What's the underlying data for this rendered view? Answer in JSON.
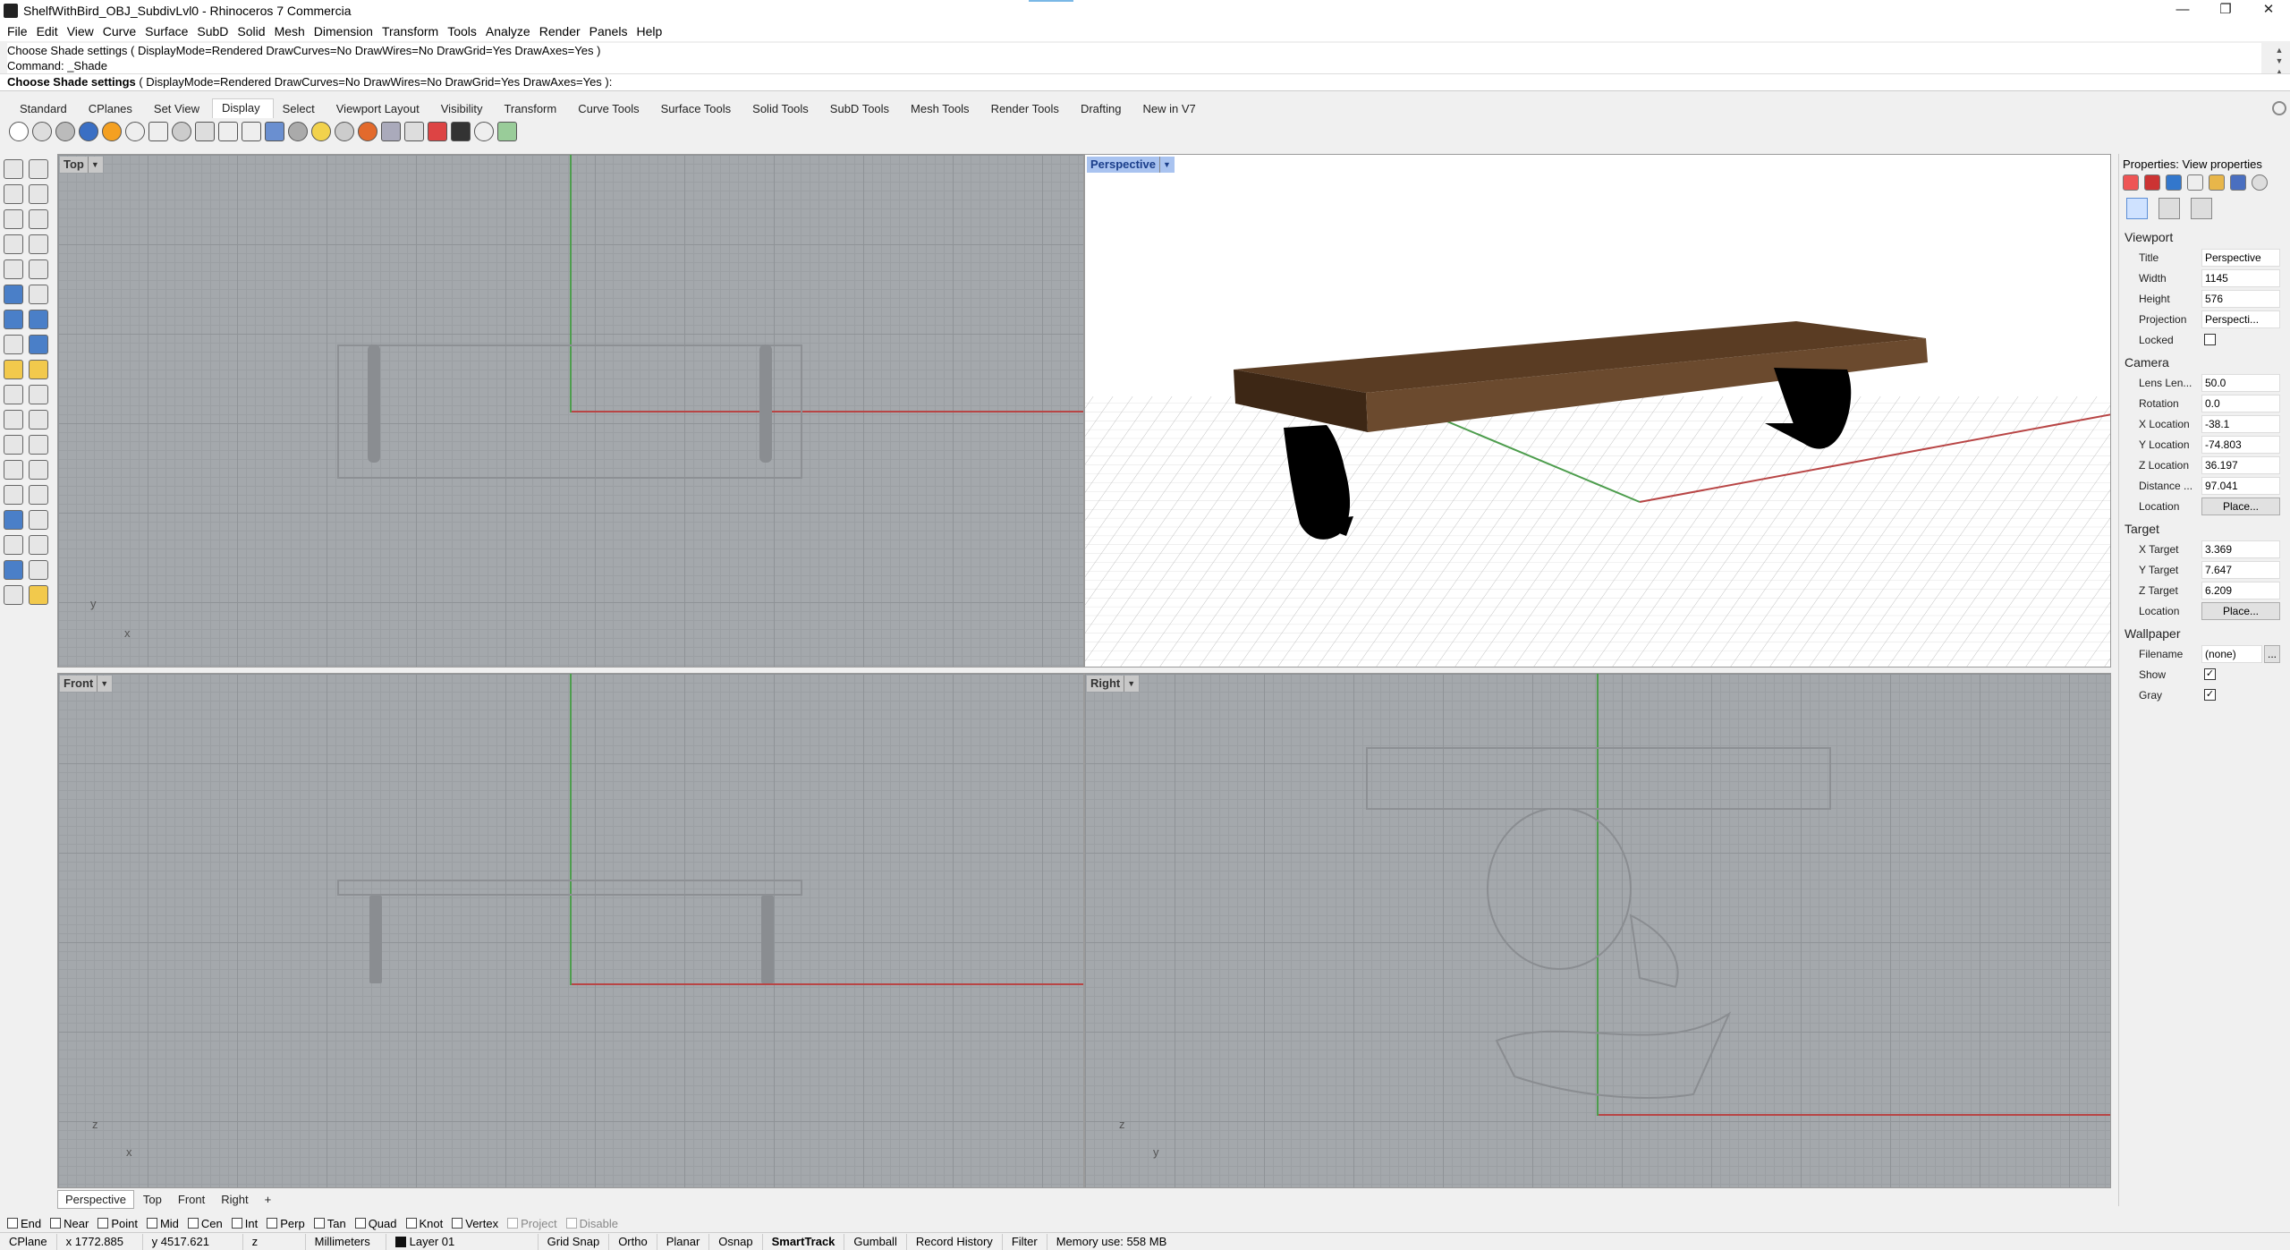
{
  "window": {
    "title": "ShelfWithBird_OBJ_SubdivLvl0 - Rhinoceros 7 Commercia",
    "controls": [
      "—",
      "❐",
      "✕"
    ]
  },
  "menu": [
    "File",
    "Edit",
    "View",
    "Curve",
    "Surface",
    "SubD",
    "Solid",
    "Mesh",
    "Dimension",
    "Transform",
    "Tools",
    "Analyze",
    "Render",
    "Panels",
    "Help"
  ],
  "command": {
    "history_line1": "Choose Shade settings ( DisplayMode=Rendered  DrawCurves=No  DrawWires=No  DrawGrid=Yes  DrawAxes=Yes )",
    "history_line2": "Command: _Shade",
    "prompt_bold": "Choose Shade settings",
    "prompt_rest": " ( DisplayMode=Rendered  DrawCurves=No  DrawWires=No  DrawGrid=Yes  DrawAxes=Yes ):"
  },
  "toolbar_tabs": [
    "Standard",
    "CPlanes",
    "Set View",
    "Display",
    "Select",
    "Viewport Layout",
    "Visibility",
    "Transform",
    "Curve Tools",
    "Surface Tools",
    "Solid Tools",
    "SubD Tools",
    "Mesh Tools",
    "Render Tools",
    "Drafting",
    "New in V7"
  ],
  "active_tab": "Display",
  "viewports": {
    "top": {
      "label": "Top",
      "axis1": "y",
      "axis2": "x"
    },
    "perspective": {
      "label": "Perspective"
    },
    "front": {
      "label": "Front",
      "axis1": "z",
      "axis2": "x"
    },
    "right": {
      "label": "Right",
      "axis1": "z",
      "axis2": "y"
    }
  },
  "viewport_tabs": [
    "Perspective",
    "Top",
    "Front",
    "Right",
    "+"
  ],
  "panel": {
    "title": "Properties: View properties",
    "viewport_section": "Viewport",
    "title_label": "Title",
    "title_value": "Perspective",
    "width_label": "Width",
    "width_value": "1145",
    "height_label": "Height",
    "height_value": "576",
    "projection_label": "Projection",
    "projection_value": "Perspecti...",
    "locked_label": "Locked",
    "camera_section": "Camera",
    "lens_label": "Lens Len...",
    "lens_value": "50.0",
    "rotation_label": "Rotation",
    "rotation_value": "0.0",
    "xloc_label": "X Location",
    "xloc_value": "-38.1",
    "yloc_label": "Y Location",
    "yloc_value": "-74.803",
    "zloc_label": "Z Location",
    "zloc_value": "36.197",
    "distance_label": "Distance ...",
    "distance_value": "97.041",
    "location_label": "Location",
    "place_button": "Place...",
    "target_section": "Target",
    "xt_label": "X Target",
    "xt_value": "3.369",
    "yt_label": "Y Target",
    "yt_value": "7.647",
    "zt_label": "Z Target",
    "zt_value": "6.209",
    "tlocation_label": "Location",
    "wallpaper_section": "Wallpaper",
    "filename_label": "Filename",
    "filename_value": "(none)",
    "browse": "...",
    "show_label": "Show",
    "gray_label": "Gray",
    "check": "✓"
  },
  "osnaps": [
    {
      "label": "End",
      "checked": false
    },
    {
      "label": "Near",
      "checked": false
    },
    {
      "label": "Point",
      "checked": false
    },
    {
      "label": "Mid",
      "checked": false
    },
    {
      "label": "Cen",
      "checked": false
    },
    {
      "label": "Int",
      "checked": false
    },
    {
      "label": "Perp",
      "checked": false
    },
    {
      "label": "Tan",
      "checked": false
    },
    {
      "label": "Quad",
      "checked": false
    },
    {
      "label": "Knot",
      "checked": false
    },
    {
      "label": "Vertex",
      "checked": false
    },
    {
      "label": "Project",
      "checked": false,
      "disabled": true
    },
    {
      "label": "Disable",
      "checked": false,
      "disabled": true
    }
  ],
  "status": {
    "cplane": "CPlane",
    "x": "x 1772.885",
    "y": "y 4517.621",
    "z": "z",
    "units": "Millimeters",
    "layer": "Layer 01",
    "grid_snap": "Grid Snap",
    "ortho": "Ortho",
    "planar": "Planar",
    "osnap": "Osnap",
    "smarttrack": "SmartTrack",
    "gumball": "Gumball",
    "record_history": "Record History",
    "filter": "Filter",
    "memory": "Memory use: 558 MB"
  },
  "colors": {
    "accent": "#a9c3f0",
    "axis_x": "#b84545",
    "axis_y": "#4d9d4d",
    "shelf_wood": "#6b4a2e"
  }
}
